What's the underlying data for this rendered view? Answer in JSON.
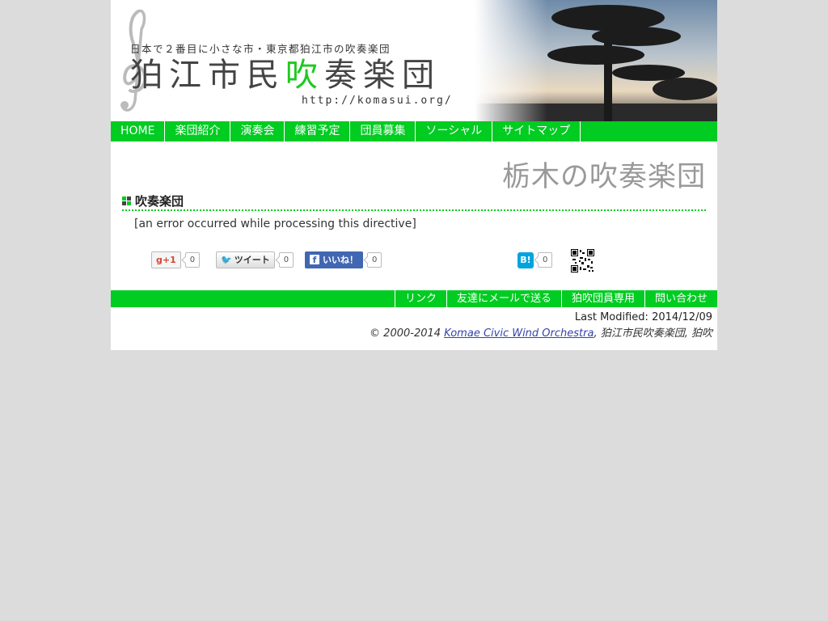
{
  "header": {
    "tagline": "日本で２番目に小さな市・東京都狛江市の吹奏楽団",
    "org_name_part1": "狛江市民",
    "org_name_accent": "吹",
    "org_name_part2": "奏楽団",
    "url": "http://komasui.org/"
  },
  "nav": {
    "items": [
      {
        "label": "HOME"
      },
      {
        "label": "楽団紹介"
      },
      {
        "label": "演奏会"
      },
      {
        "label": "練習予定"
      },
      {
        "label": "団員募集"
      },
      {
        "label": "ソーシャル"
      },
      {
        "label": "サイトマップ"
      }
    ]
  },
  "main": {
    "page_title": "栃木の吹奏楽団",
    "section_heading": "吹奏楽団",
    "error_text": "[an error occurred while processing this directive]"
  },
  "social": {
    "gplus_label": "+1",
    "gplus_count": "0",
    "tweet_label": "ツイート",
    "tweet_count": "0",
    "like_label": "いいね！",
    "like_count": "0",
    "hatena_label": "B!",
    "hatena_count": "0"
  },
  "footer_nav": {
    "items": [
      {
        "label": "リンク"
      },
      {
        "label": "友達にメールで送る"
      },
      {
        "label": "狛吹団員専用"
      },
      {
        "label": "問い合わせ"
      }
    ]
  },
  "footer": {
    "last_modified": "Last Modified: 2014/12/09",
    "copyright_prefix": "© 2000-2014 ",
    "copyright_link": "Komae Civic Wind Orchestra",
    "copyright_suffix": ", 狛江市民吹奏楽団, 狛吹"
  },
  "colors": {
    "accent_green": "#00cc22",
    "background": "#dcdcdc",
    "title_gray": "#999999"
  }
}
